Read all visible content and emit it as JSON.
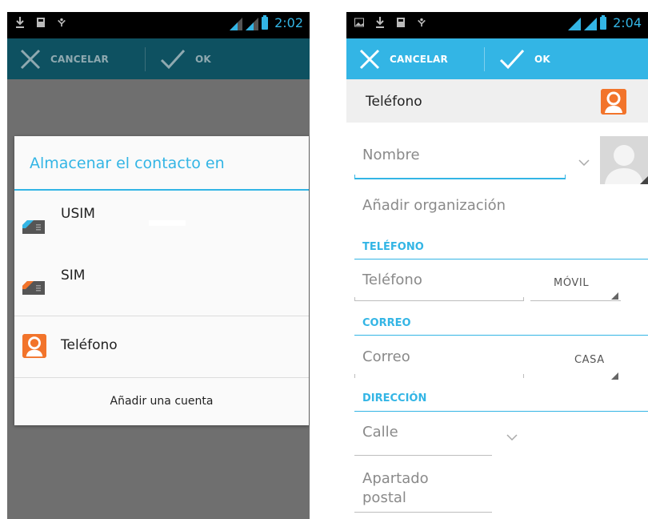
{
  "left": {
    "status": {
      "time": "2:02"
    },
    "actionbar": {
      "cancel_label": "CANCELAR",
      "ok_label": "OK"
    },
    "dialog": {
      "title": "Almacenar el contacto en",
      "items": [
        {
          "label": "USIM",
          "icon": "sim-card-icon-blue"
        },
        {
          "label": "SIM",
          "icon": "sim-card-icon-orange"
        },
        {
          "label": "Teléfono",
          "icon": "phone-contact-icon"
        }
      ],
      "footer": "Añadir una cuenta"
    }
  },
  "right": {
    "status": {
      "time": "2:04"
    },
    "actionbar": {
      "cancel_label": "CANCELAR",
      "ok_label": "OK"
    },
    "account": {
      "label": "Teléfono",
      "icon": "phone-contact-icon"
    },
    "form": {
      "name_placeholder": "Nombre",
      "org_label": "Añadir organización",
      "phone_section": "TELÉFONO",
      "phone_placeholder": "Teléfono",
      "phone_type": "MÓVIL",
      "email_section": "CORREO",
      "email_placeholder": "Correo",
      "email_type": "CASA",
      "address_section": "DIRECCIÓN",
      "street_placeholder": "Calle",
      "pobox_placeholder_line1": "Apartado",
      "pobox_placeholder_line2": "postal"
    }
  },
  "colors": {
    "accent": "#33b5e5",
    "dark_actionbar": "#0e5161",
    "contact_orange": "#f2742b"
  }
}
